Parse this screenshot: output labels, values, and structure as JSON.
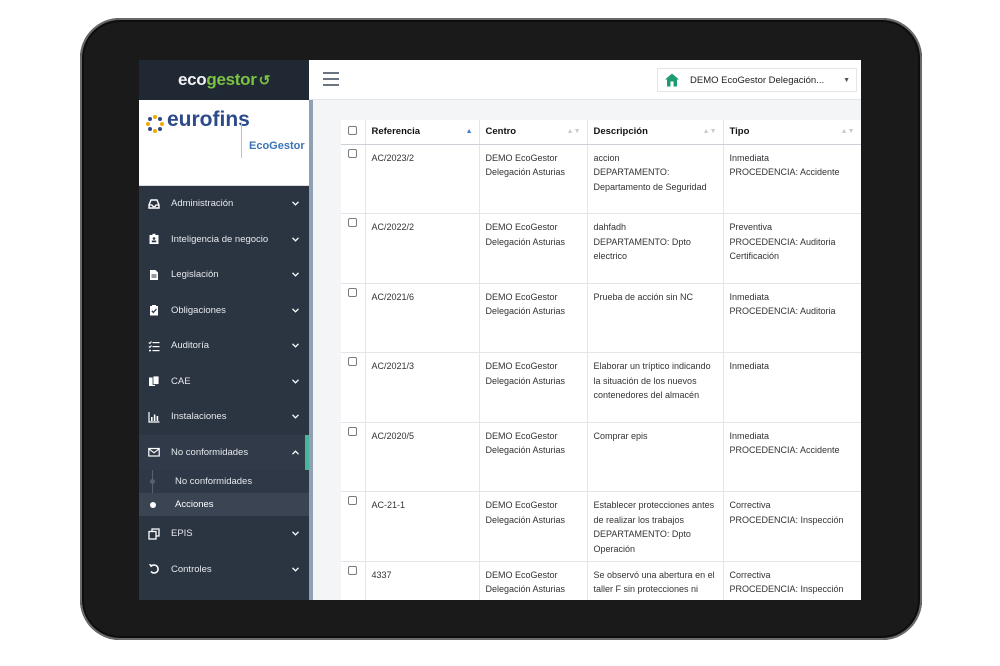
{
  "app": {
    "logo_part1": "eco",
    "logo_part2": "gestor",
    "brand_name": "eurofins",
    "brand_product": "EcoGestor"
  },
  "header": {
    "organization": "DEMO EcoGestor Delegación..."
  },
  "sidebar": {
    "items": [
      {
        "label": "Administración",
        "icon": "inbox-icon"
      },
      {
        "label": "Inteligencia de negocio",
        "icon": "id-badge-icon"
      },
      {
        "label": "Legislación",
        "icon": "document-icon"
      },
      {
        "label": "Obligaciones",
        "icon": "clipboard-check-icon"
      },
      {
        "label": "Auditoría",
        "icon": "list-check-icon"
      },
      {
        "label": "CAE",
        "icon": "files-icon"
      },
      {
        "label": "Instalaciones",
        "icon": "bar-chart-icon"
      },
      {
        "label": "No conformidades",
        "icon": "envelope-icon"
      },
      {
        "label": "EPIS",
        "icon": "copy-icon"
      },
      {
        "label": "Controles",
        "icon": "undo-icon"
      }
    ],
    "submenu": [
      {
        "label": "No conformidades"
      },
      {
        "label": "Acciones"
      }
    ]
  },
  "table": {
    "columns": [
      "Referencia",
      "Centro",
      "Descripción",
      "Tipo"
    ],
    "rows": [
      {
        "ref": "AC/2023/2",
        "centro": [
          "DEMO EcoGestor",
          "Delegación Asturias"
        ],
        "desc": [
          "accion",
          "DEPARTAMENTO:",
          "Departamento de Seguridad"
        ],
        "tipo": [
          "Inmediata",
          "PROCEDENCIA: Accidente"
        ]
      },
      {
        "ref": "AC/2022/2",
        "centro": [
          "DEMO EcoGestor",
          "Delegación Asturias"
        ],
        "desc": [
          "dahfadh",
          "DEPARTAMENTO: Dpto",
          "electrico"
        ],
        "tipo": [
          "Preventiva",
          "PROCEDENCIA: Auditoria",
          "Certificación"
        ]
      },
      {
        "ref": "AC/2021/6",
        "centro": [
          "DEMO EcoGestor",
          "Delegación Asturias"
        ],
        "desc": [
          "Prueba de acción sin NC",
          "",
          ""
        ],
        "tipo": [
          "Inmediata",
          "PROCEDENCIA: Auditoria",
          ""
        ]
      },
      {
        "ref": "AC/2021/3",
        "centro": [
          "DEMO EcoGestor",
          "Delegación Asturias"
        ],
        "desc": [
          "Elaborar un tríptico indicando",
          "la situación de los nuevos",
          "contenedores del almacén"
        ],
        "tipo": [
          "Inmediata",
          "",
          ""
        ]
      },
      {
        "ref": "AC/2020/5",
        "centro": [
          "DEMO EcoGestor",
          "Delegación Asturias"
        ],
        "desc": [
          "Comprar epis",
          "",
          ""
        ],
        "tipo": [
          "Inmediata",
          "PROCEDENCIA: Accidente",
          ""
        ]
      },
      {
        "ref": "AC-21-1",
        "centro": [
          "DEMO EcoGestor",
          "Delegación Asturias"
        ],
        "desc": [
          "Establecer protecciones antes",
          "de realizar los trabajos",
          "DEPARTAMENTO: Dpto",
          "Operación"
        ],
        "tipo": [
          "Correctiva",
          "PROCEDENCIA: Inspección",
          ""
        ]
      },
      {
        "ref": "4337",
        "centro": [
          "DEMO EcoGestor",
          "Delegación Asturias"
        ],
        "desc": [
          "Se observó una abertura en el",
          "taller F sin protecciones ni",
          ""
        ],
        "tipo": [
          "Correctiva",
          "PROCEDENCIA: Inspección",
          ""
        ]
      }
    ]
  },
  "colors": {
    "sidebar_bg": "#2b3441",
    "accent": "#47b59a",
    "brand_blue": "#2d4b8a",
    "logo_green": "#7cc243"
  }
}
